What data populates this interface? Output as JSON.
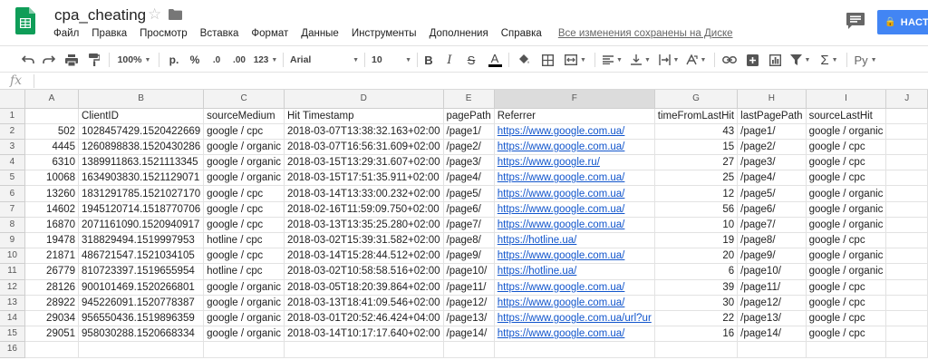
{
  "doc": {
    "title": "cpa_cheating"
  },
  "menu": [
    "Файл",
    "Правка",
    "Просмотр",
    "Вставка",
    "Формат",
    "Данные",
    "Инструменты",
    "Дополнения",
    "Справка"
  ],
  "saved_status": "Все изменения сохранены на Диске",
  "share_label": "НАСТР",
  "toolbar": {
    "zoom": "100%",
    "currency": "р.",
    "percent": "%",
    "dec_less": ".0",
    "dec_more": ".00",
    "format_more": "123",
    "font": "Arial",
    "size": "10",
    "bold": "B",
    "italic": "I",
    "strike": "S",
    "text_color": "A",
    "input_tools": "Ру",
    "sum": "Σ"
  },
  "fx_label": "fx",
  "column_letters": [
    "A",
    "B",
    "C",
    "D",
    "E",
    "F",
    "G",
    "H",
    "I",
    "J"
  ],
  "row_numbers": [
    "1",
    "2",
    "3",
    "4",
    "5",
    "6",
    "7",
    "8",
    "9",
    "10",
    "11",
    "12",
    "13",
    "14",
    "15",
    "16"
  ],
  "headers": [
    "",
    "ClientID",
    "sourceMedium",
    "Hit Timestamp",
    "pagePath",
    "Referrer",
    "timeFromLastHit",
    "lastPagePath",
    "sourceLastHit",
    ""
  ],
  "rows": [
    [
      "502",
      "1028457429.1520422669",
      "google / cpc",
      "2018-03-07T13:38:32.163+02:00",
      "/page1/",
      "https://www.google.com.ua/",
      "43",
      "/page1/",
      "google / organic"
    ],
    [
      "4445",
      "1260898838.1520430286",
      "google / organic",
      "2018-03-07T16:56:31.609+02:00",
      "/page2/",
      "https://www.google.com.ua/",
      "15",
      "/page2/",
      "google / cpc"
    ],
    [
      "6310",
      "1389911863.1521113345",
      "google / organic",
      "2018-03-15T13:29:31.607+02:00",
      "/page3/",
      "https://www.google.ru/",
      "27",
      "/page3/",
      "google / cpc"
    ],
    [
      "10068",
      "1634903830.1521129071",
      "google / organic",
      "2018-03-15T17:51:35.911+02:00",
      "/page4/",
      "https://www.google.com.ua/",
      "25",
      "/page4/",
      "google / cpc"
    ],
    [
      "13260",
      "1831291785.1521027170",
      "google / cpc",
      "2018-03-14T13:33:00.232+02:00",
      "/page5/",
      "https://www.google.com.ua/",
      "12",
      "/page5/",
      "google / organic"
    ],
    [
      "14602",
      "1945120714.1518770706",
      "google / cpc",
      "2018-02-16T11:59:09.750+02:00",
      "/page6/",
      "https://www.google.com.ua/",
      "56",
      "/page6/",
      "google / organic"
    ],
    [
      "16870",
      "2071161090.1520940917",
      "google / cpc",
      "2018-03-13T13:35:25.280+02:00",
      "/page7/",
      "https://www.google.com.ua/",
      "10",
      "/page7/",
      "google / organic"
    ],
    [
      "19478",
      "318829494.1519997953",
      "hotline / cpc",
      "2018-03-02T15:39:31.582+02:00",
      "/page8/",
      "https://hotline.ua/",
      "19",
      "/page8/",
      "google / cpc"
    ],
    [
      "21871",
      "486721547.1521034105",
      "google / cpc",
      "2018-03-14T15:28:44.512+02:00",
      "/page9/",
      "https://www.google.com.ua/",
      "20",
      "/page9/",
      "google / organic"
    ],
    [
      "26779",
      "810723397.1519655954",
      "hotline / cpc",
      "2018-03-02T10:58:58.516+02:00",
      "/page10/",
      "https://hotline.ua/",
      "6",
      "/page10/",
      "google / organic"
    ],
    [
      "28126",
      "900101469.1520266801",
      "google / organic",
      "2018-03-05T18:20:39.864+02:00",
      "/page11/",
      "https://www.google.com.ua/",
      "39",
      "/page11/",
      "google / cpc"
    ],
    [
      "28922",
      "945226091.1520778387",
      "google / organic",
      "2018-03-13T18:41:09.546+02:00",
      "/page12/",
      "https://www.google.com.ua/",
      "30",
      "/page12/",
      "google / cpc"
    ],
    [
      "29034",
      "956550436.1519896359",
      "google / organic",
      "2018-03-01T20:52:46.424+04:00",
      "/page13/",
      "https://www.google.com.ua/url?ur",
      "22",
      "/page13/",
      "google / cpc"
    ],
    [
      "29051",
      "958030288.1520668334",
      "google / organic",
      "2018-03-14T10:17:17.640+02:00",
      "/page14/",
      "https://www.google.com.ua/",
      "16",
      "/page14/",
      "google / cpc"
    ]
  ],
  "colors": {
    "accent": "#4285f4",
    "link": "#1155cc",
    "sheets_green": "#0f9d58"
  }
}
